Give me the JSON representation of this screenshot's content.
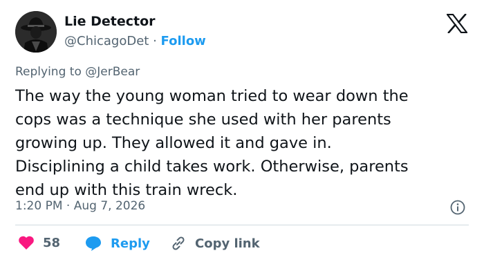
{
  "author": {
    "name": "Lie Detector",
    "handle": "@ChicagoDet",
    "separator": "·",
    "follow_label": "Follow",
    "avatar_icon": "detective-silhouette-avatar"
  },
  "platform_icon": "x-logo-icon",
  "reply_context": {
    "prefix": "Replying to ",
    "mention": "@JerBear"
  },
  "post": {
    "text": "The way the young woman tried to wear down the\ncops was a technique she used with her parents\ngrowing up. They allowed it and gave in.\nDisciplining a child takes work. Otherwise, parents\nend up with this train wreck.",
    "time": "1:20 PM",
    "separator": "·",
    "date": "Aug 7, 2026"
  },
  "actions": {
    "likes_count": "58",
    "reply_label": "Reply",
    "copy_link_label": "Copy link"
  },
  "colors": {
    "like": "#f91880",
    "reply": "#1d9bf0",
    "link_blue": "#1d9bf0",
    "muted": "#536471",
    "text": "#0f1419",
    "divider": "#cfd9de"
  }
}
